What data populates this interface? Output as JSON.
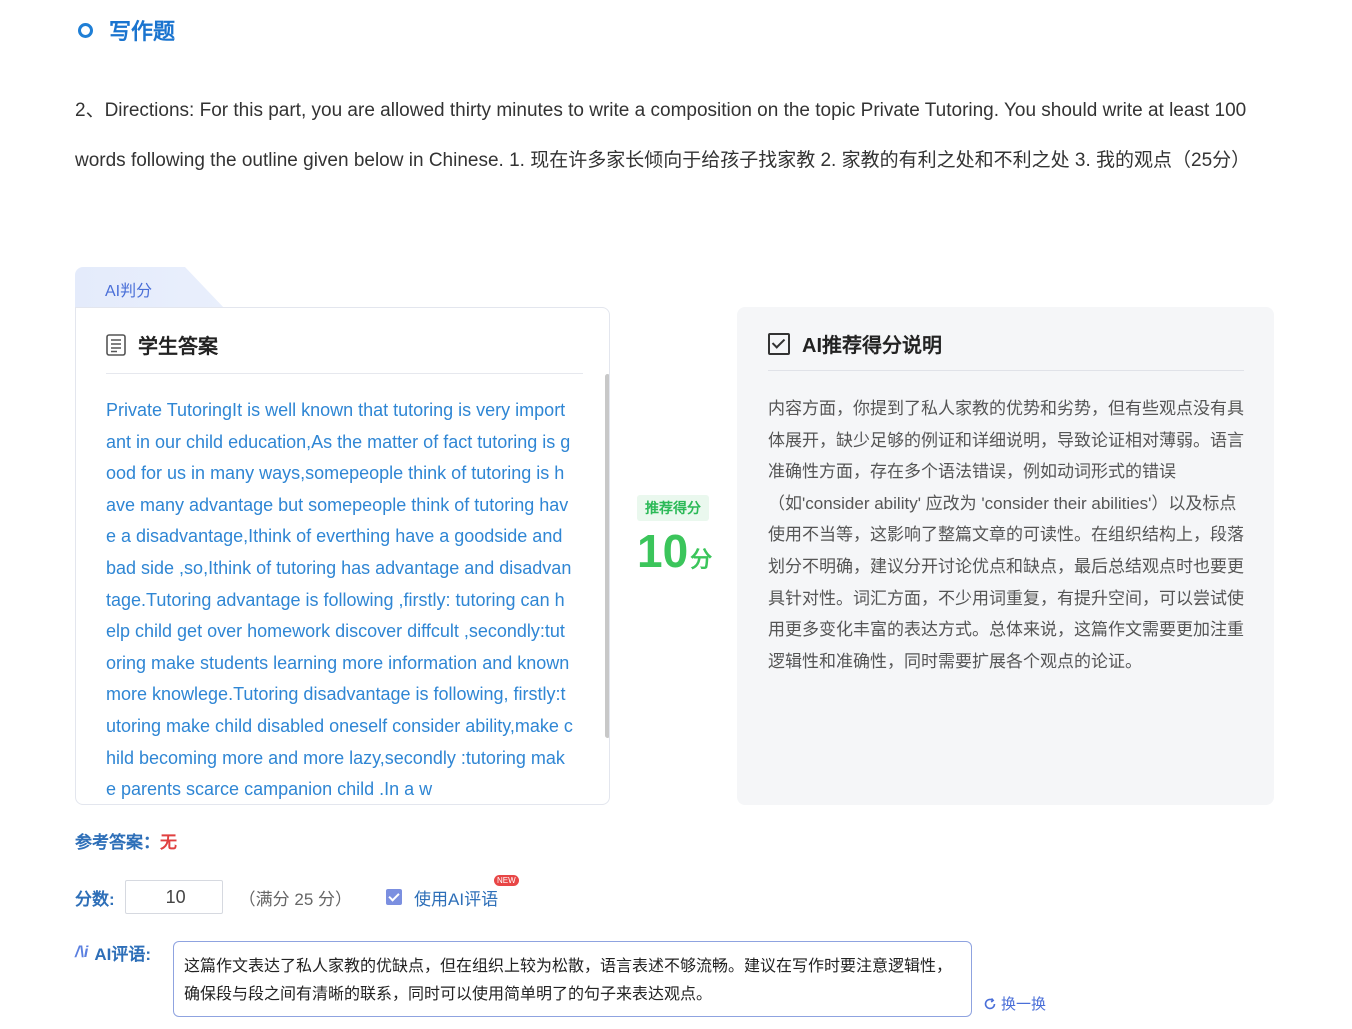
{
  "section": {
    "title": "写作题"
  },
  "question": {
    "text": "2、Directions: For this part, you are allowed thirty minutes to write a composition on the topic Private Tutoring. You should write at least 100 words following the outline given below in Chinese. 1. 现在许多家长倾向于给孩子找家教 2. 家教的有利之处和不利之处 3. 我的观点（25分）"
  },
  "ai_tab": {
    "label": "AI判分"
  },
  "student_answer": {
    "title": "学生答案",
    "text": "Private TutoringIt is well known that tutoring is very important in our child education,As the matter of fact tutoring is good for us in many ways,somepeople think of tutoring is have many advantage but somepeople think of tutoring have a disadvantage,Ithink of everthing have a goodside and bad side ,so,Ithink of tutoring has advantage and disadvantage.Tutoring advantage is following ,firstly: tutoring can help child get over homework discover diffcult ,secondly:tutoring make students learning more information and known more knowlege.Tutoring disadvantage is following, firstly:tutoring make child disabled oneself consider ability,make child becoming more and more lazy,secondly :tutoring make parents scarce campanion child .In a w"
  },
  "recommend": {
    "badge": "推荐得分",
    "score": "10",
    "unit": "分"
  },
  "explanation": {
    "title": "AI推荐得分说明",
    "text": "内容方面，你提到了私人家教的优势和劣势，但有些观点没有具体展开，缺少足够的例证和详细说明，导致论证相对薄弱。语言准确性方面，存在多个语法错误，例如动词形式的错误（如'consider ability' 应改为 'consider their abilities'）以及标点使用不当等，这影响了整篇文章的可读性。在组织结构上，段落划分不明确，建议分开讨论优点和缺点，最后总结观点时也要更具针对性。词汇方面，不少用词重复，有提升空间，可以尝试使用更多变化丰富的表达方式。总体来说，这篇作文需要更加注重逻辑性和准确性，同时需要扩展各个观点的论证。"
  },
  "reference": {
    "label": "参考答案：",
    "value": "无"
  },
  "score_row": {
    "label": "分数:",
    "value": "10",
    "full_note": "（满分 25 分）",
    "use_ai_label": "使用AI评语",
    "new_badge": "NEW"
  },
  "comment": {
    "label": "AI评语:",
    "text": "这篇作文表达了私人家教的优缺点，但在组织上较为松散，语言表述不够流畅。建议在写作时要注意逻辑性，确保段与段之间有清晰的联系，同时可以使用简单明了的句子来表达观点。",
    "refresh_label": "换一换"
  },
  "colors": {
    "accent": "#1a74cf",
    "score_green": "#3bc55b",
    "answer_blue": "#2f86d4"
  }
}
